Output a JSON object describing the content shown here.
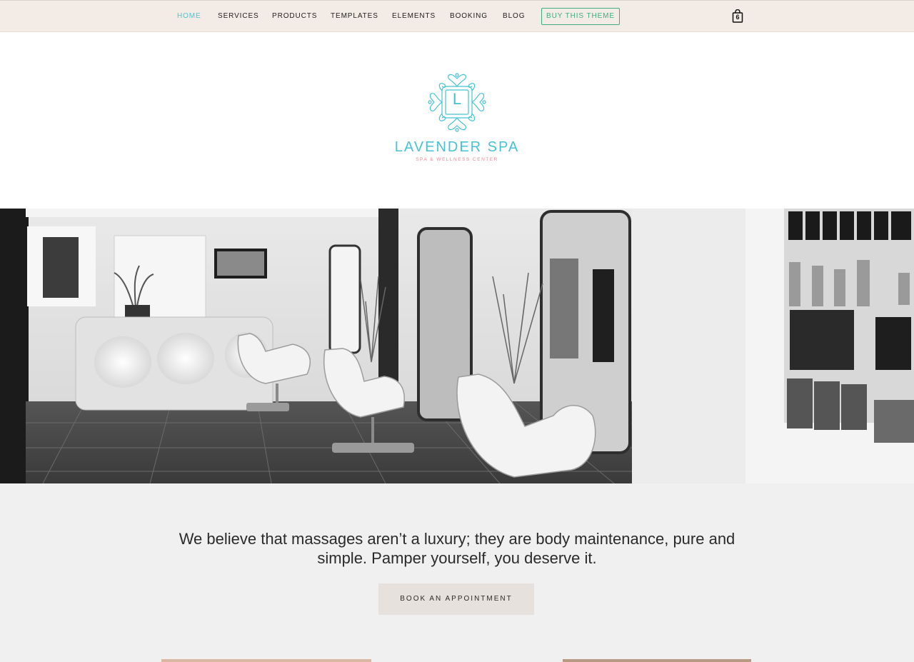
{
  "nav": {
    "items": [
      {
        "label": "HOME",
        "active": true
      },
      {
        "label": "SERVICES",
        "active": false
      },
      {
        "label": "PRODUCTS",
        "active": false
      },
      {
        "label": "TEMPLATES",
        "active": false
      },
      {
        "label": "ELEMENTS",
        "active": false
      },
      {
        "label": "BOOKING",
        "active": false
      },
      {
        "label": "BLOG",
        "active": false
      }
    ],
    "buy_label": "BUY THIS THEME",
    "cart_count": "6",
    "cart_icon": "shopping-bag-icon"
  },
  "logo": {
    "letter": "L",
    "name": "LAVENDER SPA",
    "tagline": "SPA & WELLNESS CENTER",
    "icon": "ornamental-frame-icon"
  },
  "hero": {
    "image": "black-and-white salon interior with reception desk, white chairs, mirrors and product shelves"
  },
  "intro": {
    "quote": "We believe that massages aren’t a luxury; they are body maintenance, pure and simple. Pamper yourself, you deserve it.",
    "button_label": "BOOK AN APPOINTMENT"
  },
  "colors": {
    "accent": "#45c3d3",
    "buy_green": "#3fae7a",
    "nav_bg": "#f2ebe6",
    "tagline_pink": "#e48a9a",
    "section_bg": "#f0f0f0",
    "button_bg": "#e6e1dc"
  }
}
